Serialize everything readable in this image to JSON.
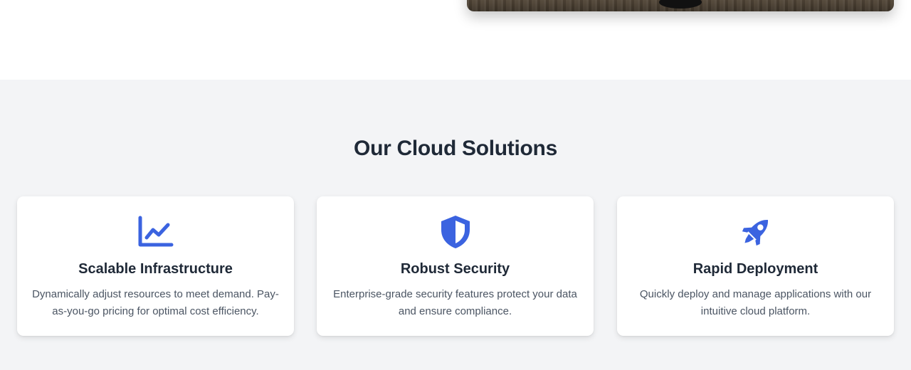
{
  "colors": {
    "accent": "#3b63e0",
    "heading": "#1f2937",
    "body_text": "#4b5563",
    "section_bg": "#f3f4f6"
  },
  "hero": {
    "image_alt": ""
  },
  "solutions": {
    "title": "Our Cloud Solutions",
    "cards": [
      {
        "icon": "chart-line-icon",
        "title": "Scalable Infrastructure",
        "description": "Dynamically adjust resources to meet demand. Pay-as-you-go pricing for optimal cost efficiency."
      },
      {
        "icon": "shield-icon",
        "title": "Robust Security",
        "description": "Enterprise-grade security features protect your data and ensure compliance."
      },
      {
        "icon": "rocket-icon",
        "title": "Rapid Deployment",
        "description": "Quickly deploy and manage applications with our intuitive cloud platform."
      }
    ]
  }
}
